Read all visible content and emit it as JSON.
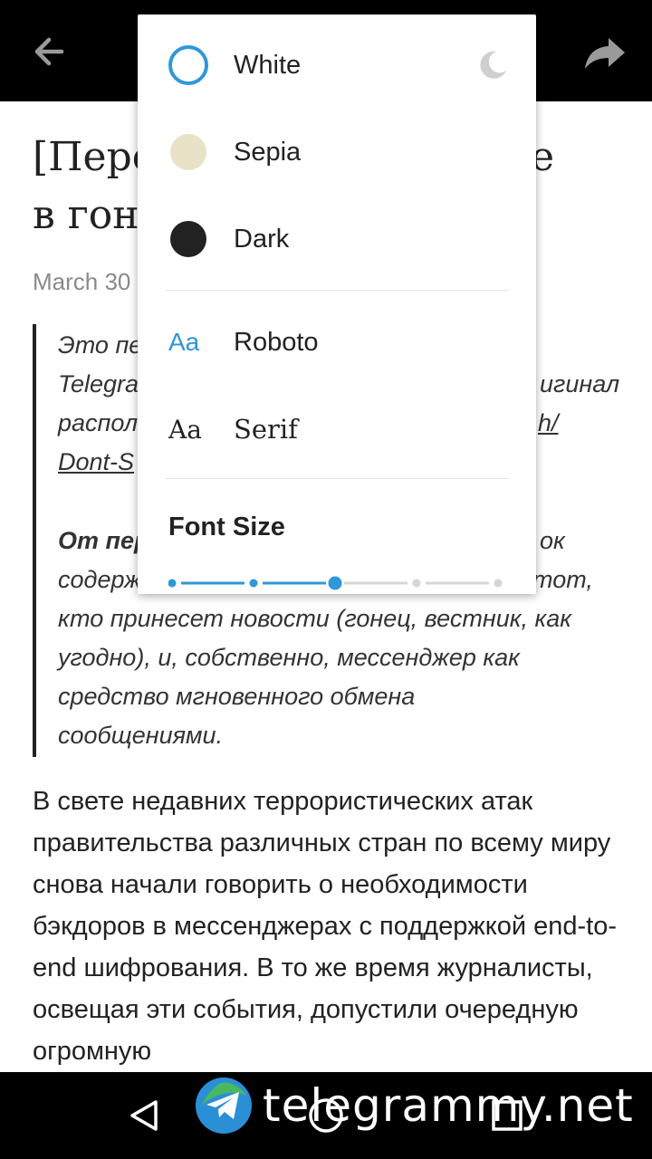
{
  "appbar": {
    "back_icon": "arrow-back-icon",
    "share_icon": "share-icon"
  },
  "article": {
    "title_line1": "[Пере",
    "title_line1_right": "е",
    "title_line2": "в гон",
    "date": "March 30",
    "quote_p1": "Это пе                                  Telegra                              игинал распол                            h/ Dont-S",
    "quote_p1_a": "Это пе",
    "quote_p1_b": "Telegra",
    "quote_p1_b_right": "игинал",
    "quote_p1_c": "распол",
    "quote_p1_c_right": "h/",
    "quote_p1_d": "Dont-S",
    "quote_p2_bold": "От пер",
    "quote_p2_bold_right": "ок",
    "quote_p2_line2": "содерж",
    "quote_p2_line2_right": "тот,",
    "quote_p2_line3": "кто принесет новости (гонец, вестник, как",
    "quote_p2_line4": "угодно), и, собственно, мессенджер как",
    "quote_p2_line5": "средство мгновенного обмена",
    "quote_p2_line6": "сообщениями.",
    "body": "В свете недавних террористических атак правительства различных стран по всему миру снова начали говорить о необходимости бэкдоров в мессенджерах с поддержкой end-to-end шифрования. В то же время журналисты, освещая эти события, допустили очередную огромную"
  },
  "popup": {
    "themes": [
      {
        "label": "White",
        "color": "#ffffff",
        "selected": true
      },
      {
        "label": "Sepia",
        "color": "#e8e2c6",
        "selected": false
      },
      {
        "label": "Dark",
        "color": "#222222",
        "selected": false
      }
    ],
    "night_icon": "moon-icon",
    "fonts": [
      {
        "sample": "Aa",
        "label": "Roboto",
        "selected": true
      },
      {
        "sample": "Aa",
        "label": "Serif",
        "selected": false
      }
    ],
    "font_size_title": "Font Size",
    "font_size": {
      "steps": 5,
      "selected_index": 2
    },
    "accent": "#2f97d9"
  },
  "navbar": {
    "back_icon": "nav-back-icon",
    "home_icon": "nav-home-icon",
    "recent_icon": "nav-recent-icon"
  },
  "watermark": {
    "text": "telegrammy.net",
    "icon": "telegram-logo-icon"
  }
}
